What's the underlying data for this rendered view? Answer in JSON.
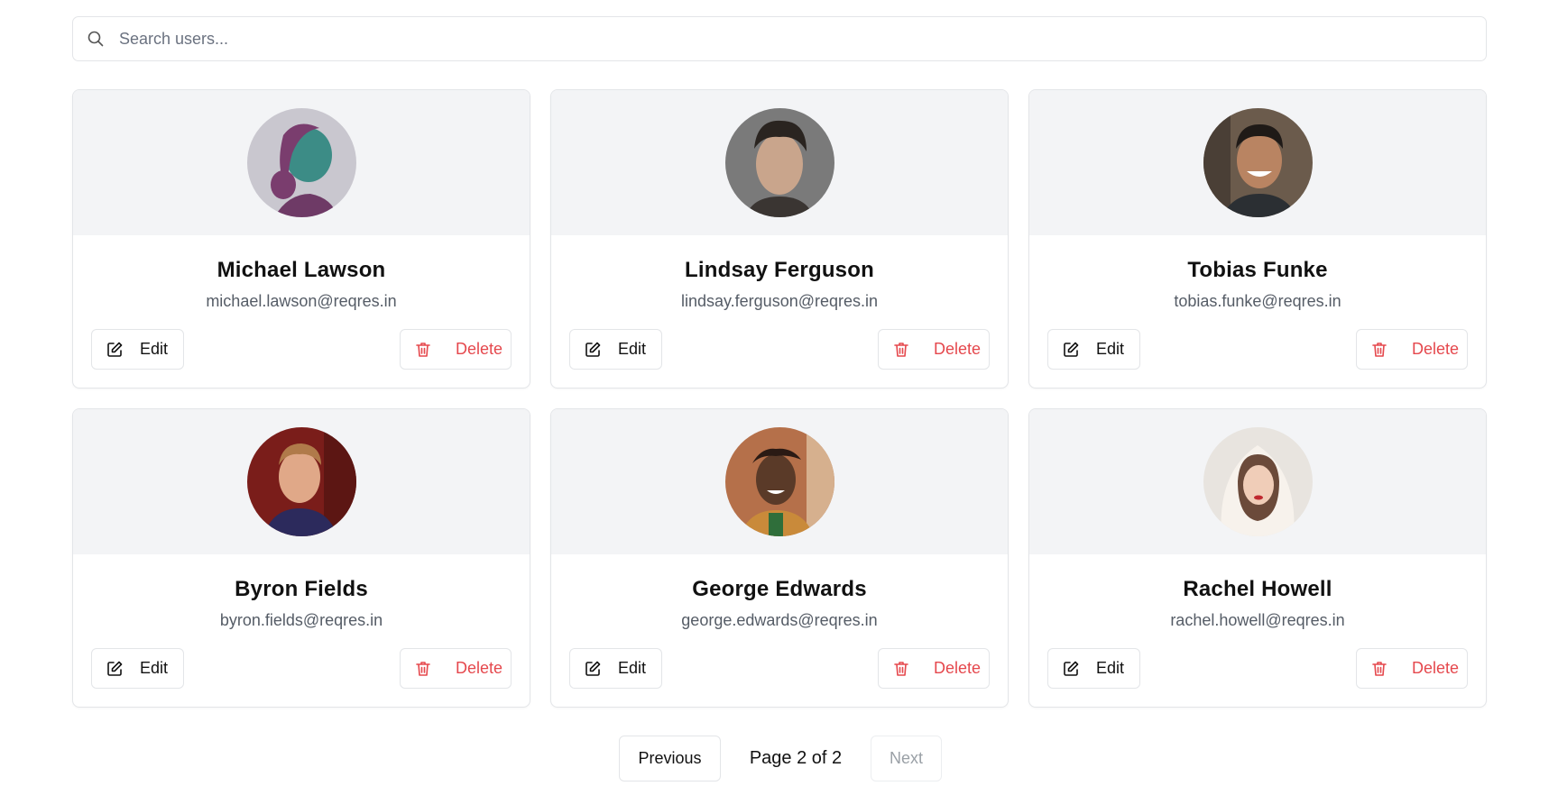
{
  "search": {
    "placeholder": "Search users...",
    "icon": "search-icon"
  },
  "users": [
    {
      "name": "Michael Lawson",
      "email": "michael.lawson@reqres.in",
      "avatar_colors": [
        "#c9c7cf",
        "#7a3d6e",
        "#3c8c86"
      ]
    },
    {
      "name": "Lindsay Ferguson",
      "email": "lindsay.ferguson@reqres.in",
      "avatar_colors": [
        "#7a7a7a",
        "#2a2420",
        "#c9a58c"
      ]
    },
    {
      "name": "Tobias Funke",
      "email": "tobias.funke@reqres.in",
      "avatar_colors": [
        "#6b5b4c",
        "#1f1a17",
        "#b98462"
      ]
    },
    {
      "name": "Byron Fields",
      "email": "byron.fields@reqres.in",
      "avatar_colors": [
        "#7a1d1a",
        "#2c2a5c",
        "#e0a888"
      ]
    },
    {
      "name": "George Edwards",
      "email": "george.edwards@reqres.in",
      "avatar_colors": [
        "#b5704a",
        "#2a1a14",
        "#5a3a28"
      ]
    },
    {
      "name": "Rachel Howell",
      "email": "rachel.howell@reqres.in",
      "avatar_colors": [
        "#e8e4df",
        "#f7f2ec",
        "#6b4a3a"
      ]
    }
  ],
  "actions": {
    "edit_label": "Edit",
    "delete_label": "Delete",
    "edit_icon": "edit-icon",
    "delete_icon": "trash-icon",
    "delete_color": "#e5484d"
  },
  "pagination": {
    "previous_label": "Previous",
    "page_info": "Page 2 of 2",
    "next_label": "Next",
    "current_page": 2,
    "total_pages": 2
  }
}
